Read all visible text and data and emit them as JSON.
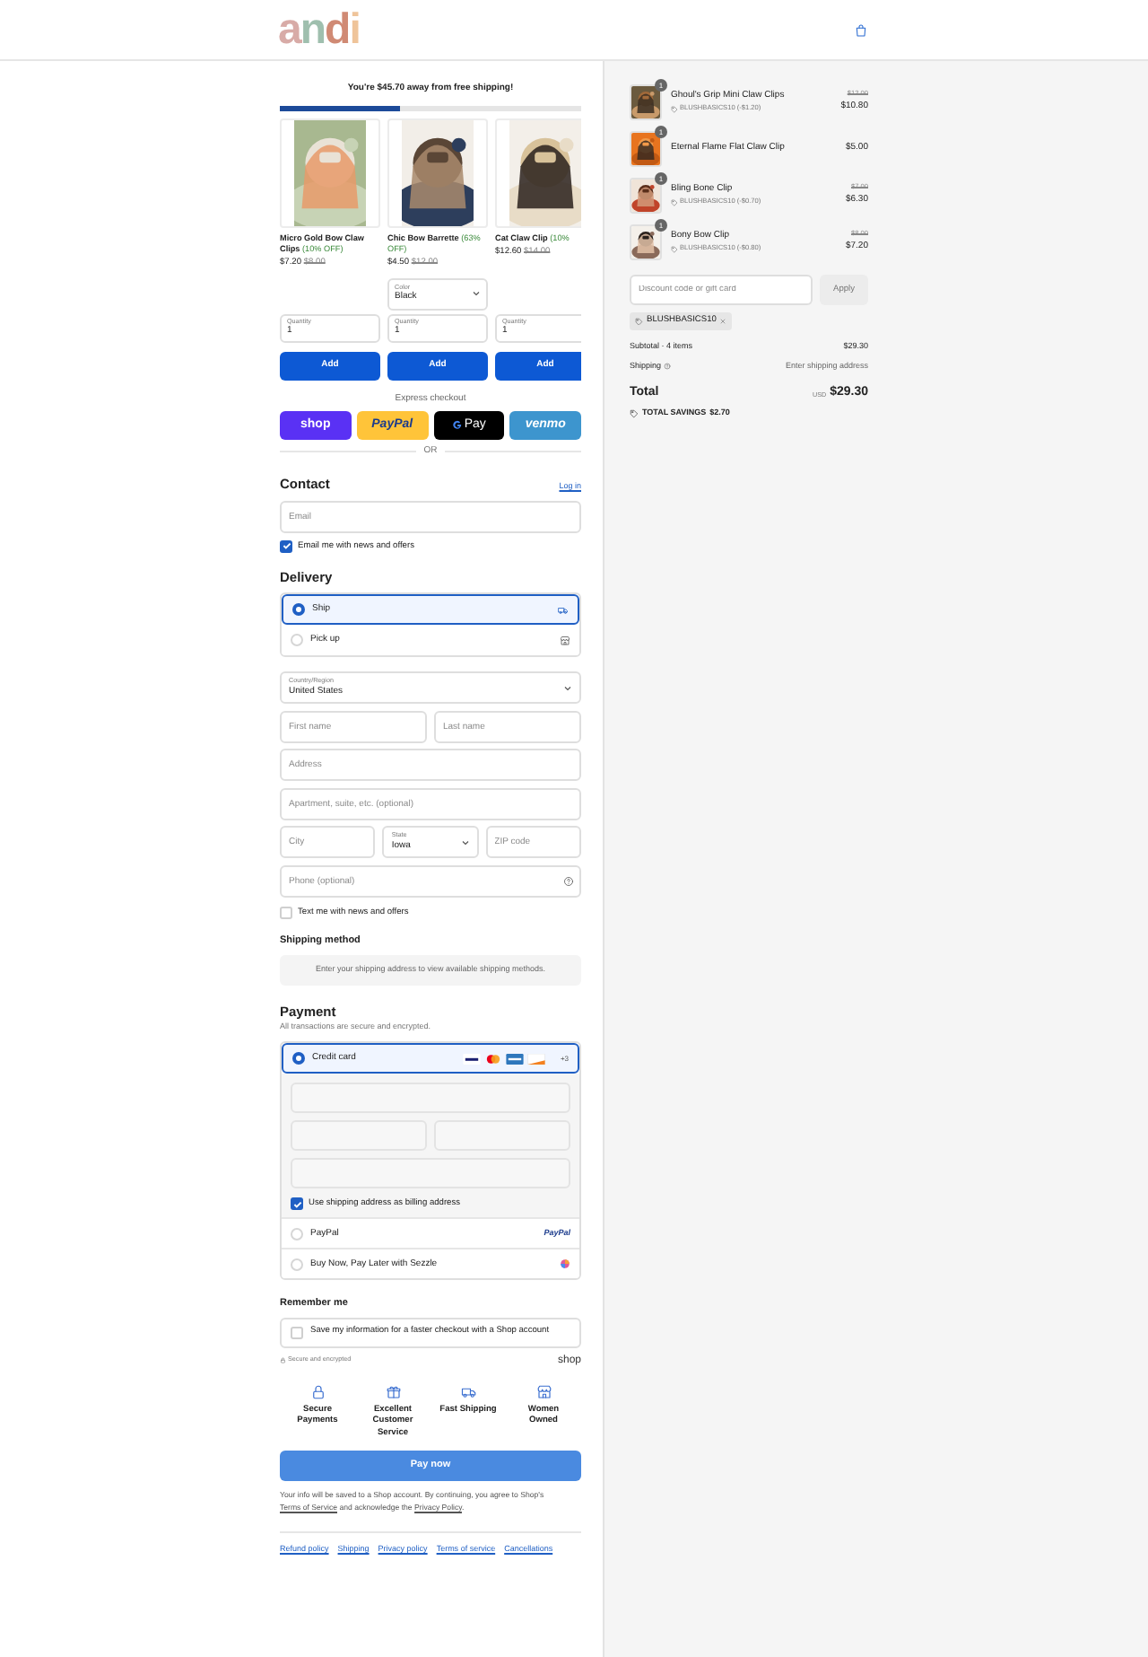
{
  "header": {
    "logo": [
      {
        "char": "a",
        "color": "#d8aba7"
      },
      {
        "char": "n",
        "color": "#9fbfae"
      },
      {
        "char": "d",
        "color": "#d08a74"
      },
      {
        "char": "i",
        "color": "#efc49a"
      }
    ]
  },
  "free_shipping": {
    "message": "You're $45.70 away from free shipping!",
    "level": 0.4
  },
  "upsell": [
    {
      "name": "Micro Gold Bow Claw Clips",
      "discount": "(10% OFF)",
      "price": "$7.20",
      "compare_price": "$8.00",
      "quantity_label": "Quantity",
      "quantity": "1",
      "button": "Add"
    },
    {
      "name": "Chic Bow Barrette",
      "discount": "(63% OFF)",
      "price": "$4.50",
      "compare_price": "$12.00",
      "option": {
        "label": "Color",
        "value": "Black"
      },
      "quantity_label": "Quantity",
      "quantity": "1",
      "button": "Add"
    },
    {
      "name": "Cat Claw Clip",
      "discount": "(10%",
      "price": "$12.60",
      "compare_price": "$14.00",
      "quantity_label": "Quantity",
      "quantity": "1",
      "button": "Add"
    }
  ],
  "express": {
    "label": "Express checkout",
    "buttons": [
      {
        "kind": "shop",
        "label": "shop"
      },
      {
        "kind": "paypal",
        "label": "PayPal"
      },
      {
        "kind": "gpay",
        "label": "Pay"
      },
      {
        "kind": "venmo",
        "label": "venmo"
      }
    ],
    "separator": "OR"
  },
  "contact": {
    "title": "Contact",
    "login": "Log in",
    "email_placeholder": "Email",
    "newsletter": {
      "label": "Email me with news and offers",
      "checked": true
    }
  },
  "delivery": {
    "title": "Delivery",
    "options": [
      {
        "kind": "ship",
        "label": "Ship",
        "selected": true
      },
      {
        "kind": "pickup",
        "label": "Pick up",
        "selected": false
      }
    ],
    "rows": [
      [
        {
          "kind": "select",
          "label": "Country/Region",
          "value": "United States"
        }
      ],
      [
        {
          "kind": "text",
          "placeholder": "First name"
        },
        {
          "kind": "text",
          "placeholder": "Last name"
        }
      ],
      [
        {
          "kind": "text",
          "placeholder": "Address"
        }
      ],
      [
        {
          "kind": "text",
          "placeholder": "Apartment, suite, etc. (optional)"
        }
      ],
      [
        {
          "kind": "text",
          "placeholder": "City"
        },
        {
          "kind": "select",
          "label": "State",
          "value": "Iowa"
        },
        {
          "kind": "text",
          "placeholder": "ZIP code"
        }
      ],
      [
        {
          "kind": "help",
          "placeholder": "Phone (optional)"
        }
      ]
    ],
    "sms": {
      "label": "Text me with news and offers",
      "checked": false
    }
  },
  "shipping_method": {
    "title": "Shipping method",
    "message": "Enter your shipping address to view available shipping methods."
  },
  "payment": {
    "title": "Payment",
    "subtitle": "All transactions are secure and encrypted.",
    "methods": [
      {
        "kind": "card",
        "label": "Credit card",
        "selected": true,
        "more": "+3"
      },
      {
        "kind": "paypal",
        "label": "PayPal",
        "selected": false,
        "logo": "PayPal"
      },
      {
        "kind": "sezzle",
        "label": "Buy Now, Pay Later with Sezzle",
        "selected": false
      }
    ],
    "billing": {
      "label": "Use shipping address as billing address",
      "checked": true
    }
  },
  "remember": {
    "title": "Remember me",
    "option": {
      "label": "Save my information for a faster checkout with a Shop account",
      "checked": false
    },
    "secure": "Secure and encrypted",
    "brand": "shop"
  },
  "badges": [
    {
      "kind": "lock",
      "label": "Secure Payments"
    },
    {
      "kind": "gift",
      "label": "Excellent Customer Service"
    },
    {
      "kind": "truck",
      "label": "Fast Shipping"
    },
    {
      "kind": "store",
      "label": "Women Owned"
    }
  ],
  "pay_button": "Pay now",
  "disclaimer": {
    "before": "Your info will be saved to a Shop account. By continuing, you agree to Shop's",
    "link1": "Terms of Service",
    "middle": "and acknowledge the",
    "link2": "Privacy Policy",
    "after": "."
  },
  "footer_links": [
    "Refund policy",
    "Shipping",
    "Privacy policy",
    "Terms of service",
    "Cancellations"
  ],
  "summary": {
    "items": [
      {
        "name": "Ghoul's Grip Mini Claw Clips",
        "quantity": "1",
        "discount": "BLUSHBASICS10 (-$1.20)",
        "compare_price": "$12.00",
        "price": "$10.80"
      },
      {
        "name": "Eternal Flame Flat Claw Clip",
        "quantity": "1",
        "price": "$5.00"
      },
      {
        "name": "Bling Bone Clip",
        "quantity": "1",
        "discount": "BLUSHBASICS10 (-$0.70)",
        "compare_price": "$7.00",
        "price": "$6.30"
      },
      {
        "name": "Bony Bow Clip",
        "quantity": "1",
        "discount": "BLUSHBASICS10 (-$0.80)",
        "compare_price": "$8.00",
        "price": "$7.20"
      }
    ],
    "discount_placeholder": "Discount code or gift card",
    "apply": "Apply",
    "applied_code": "BLUSHBASICS10",
    "subtotal_label": "Subtotal · 4 items",
    "subtotal": "$29.30",
    "shipping_label": "Shipping",
    "shipping_value": "Enter shipping address",
    "total_label": "Total",
    "currency": "USD",
    "total": "$29.30",
    "savings_label": "TOTAL SAVINGS",
    "savings": "$2.70"
  }
}
